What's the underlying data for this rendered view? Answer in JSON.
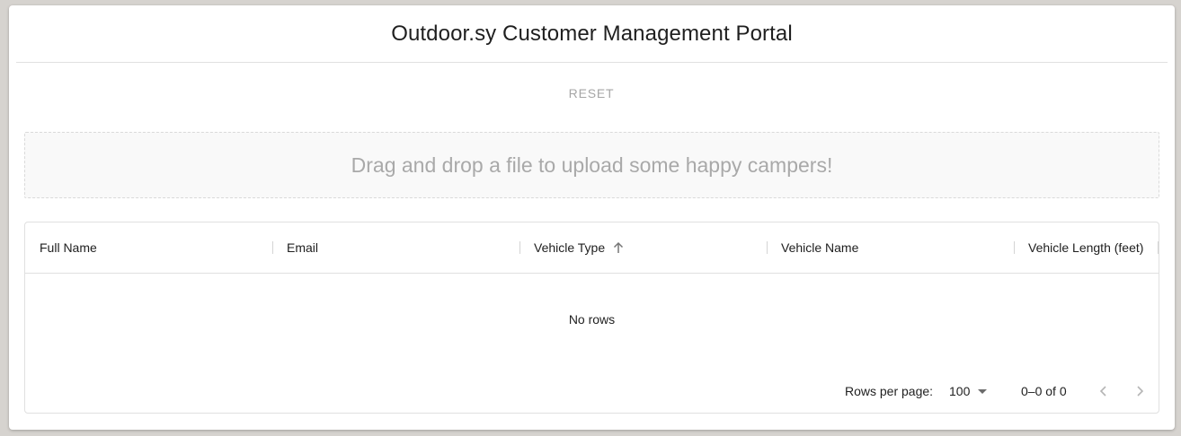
{
  "app": {
    "title": "Outdoor.sy Customer Management Portal"
  },
  "toolbar": {
    "reset_label": "RESET"
  },
  "dropzone": {
    "text": "Drag and drop a file to upload some happy campers!"
  },
  "table": {
    "columns": [
      {
        "label": "Full Name"
      },
      {
        "label": "Email"
      },
      {
        "label": "Vehicle Type",
        "sort": "ascending",
        "sort_icon": "arrow-up-icon"
      },
      {
        "label": "Vehicle Name"
      },
      {
        "label": "Vehicle Length (feet)"
      }
    ],
    "empty_text": "No rows"
  },
  "pagination": {
    "rows_per_page_label": "Rows per page:",
    "rows_per_page_value": "100",
    "range_text": "0–0 of 0",
    "prev_icon": "chevron-left-icon",
    "next_icon": "chevron-right-icon"
  },
  "colors": {
    "background": "#d6d3cf",
    "card": "#ffffff",
    "muted_text": "#a9a9a9",
    "border": "#e0e0e0"
  }
}
